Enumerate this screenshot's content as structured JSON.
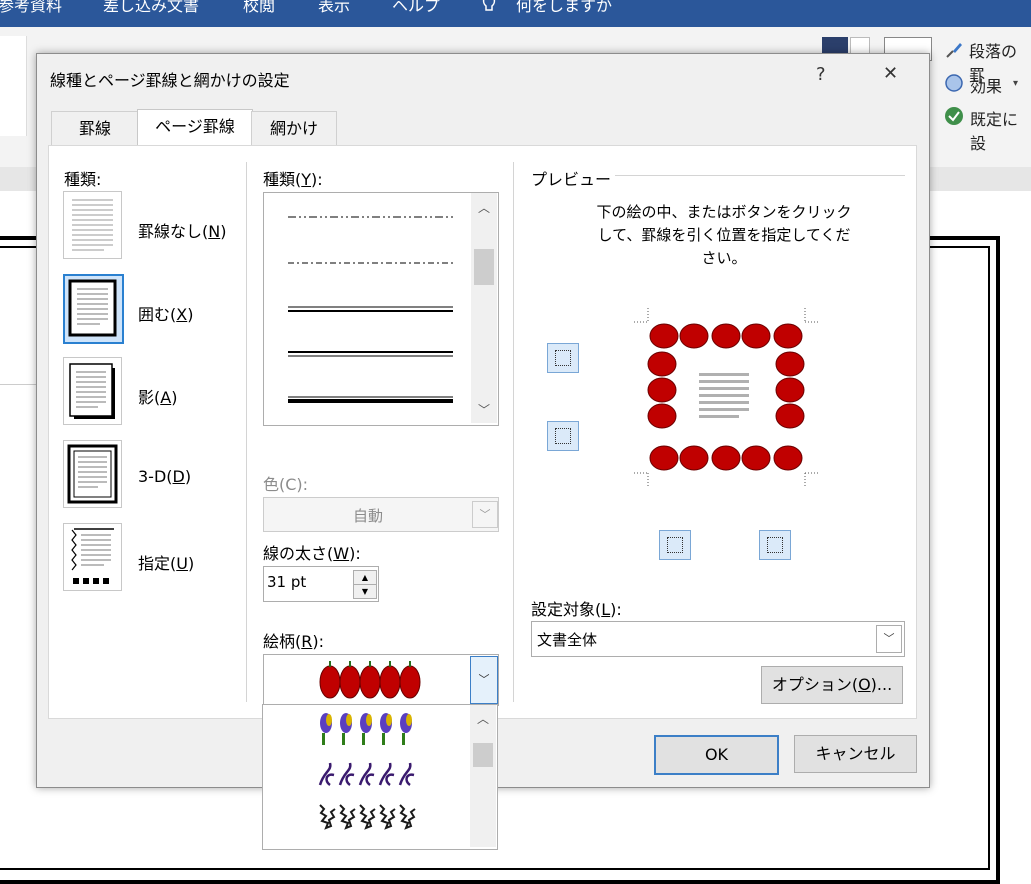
{
  "ribbon": {
    "tabs": [
      "参考資料",
      "差し込み文書",
      "校閲",
      "表示",
      "ヘルプ",
      "何をしますか"
    ],
    "right_items": [
      "段落の罫",
      "効果",
      "既定に設"
    ]
  },
  "dialog": {
    "title": "線種とページ罫線と網かけの設定",
    "help": "?",
    "close": "✕",
    "tabs": [
      "罫線",
      "ページ罫線",
      "網かけ"
    ],
    "settings_label": "種類:",
    "settings": [
      {
        "label": "罫線なし(",
        "key": "N",
        "end": ")"
      },
      {
        "label": "囲む(",
        "key": "X",
        "end": ")"
      },
      {
        "label": "影(",
        "key": "A",
        "end": ")"
      },
      {
        "label": "3-D(",
        "key": "D",
        "end": ")"
      },
      {
        "label": "指定(",
        "key": "U",
        "end": ")"
      }
    ],
    "style_label": {
      "label": "種類(",
      "key": "Y",
      "end": "):"
    },
    "color_label": "色(C):",
    "color_value": "自動",
    "width_label": {
      "label": "線の太さ(",
      "key": "W",
      "end": "):"
    },
    "width_value": "31 pt",
    "art_label": {
      "label": "絵柄(",
      "key": "R",
      "end": "):"
    },
    "preview_label": "プレビュー",
    "preview_instruction": "下の絵の中、またはボタンをクリックして、罫線を引く位置を指定してください。",
    "apply_label": {
      "label": "設定対象(",
      "key": "L",
      "end": "):"
    },
    "apply_value": "文書全体",
    "options_button": {
      "label": "オプション(",
      "key": "O",
      "end": ")..."
    },
    "ok": "OK",
    "cancel": "キャンセル"
  }
}
